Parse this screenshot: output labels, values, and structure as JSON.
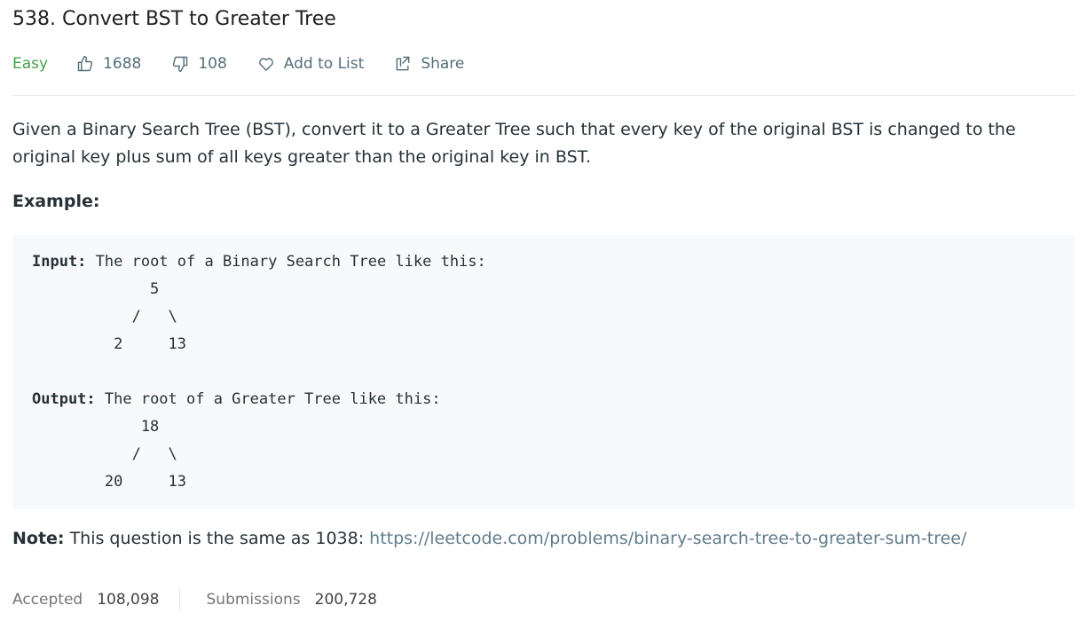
{
  "problem": {
    "title": "538. Convert BST to Greater Tree",
    "difficulty": "Easy",
    "likes": "1688",
    "dislikes": "108",
    "add_to_list_label": "Add to List",
    "share_label": "Share"
  },
  "description": {
    "text": "Given a Binary Search Tree (BST), convert it to a Greater Tree such that every key of the original BST is changed to the original key plus sum of all keys greater than the original key in BST.",
    "example_label": "Example:",
    "input_label": "Input:",
    "input_text": " The root of a Binary Search Tree like this:",
    "input_tree": "             5\n           /   \\\n         2     13",
    "output_label": "Output:",
    "output_text": " The root of a Greater Tree like this:",
    "output_tree": "            18\n           /   \\\n        20     13",
    "note_label": "Note:",
    "note_text": " This question is the same as 1038: ",
    "note_link": "https://leetcode.com/problems/binary-search-tree-to-greater-sum-tree/"
  },
  "stats": {
    "accepted_label": "Accepted",
    "accepted_value": "108,098",
    "submissions_label": "Submissions",
    "submissions_value": "200,728"
  },
  "colors": {
    "easy": "#43a047",
    "link": "#607d8b",
    "code_bg": "#f7f9fa"
  }
}
